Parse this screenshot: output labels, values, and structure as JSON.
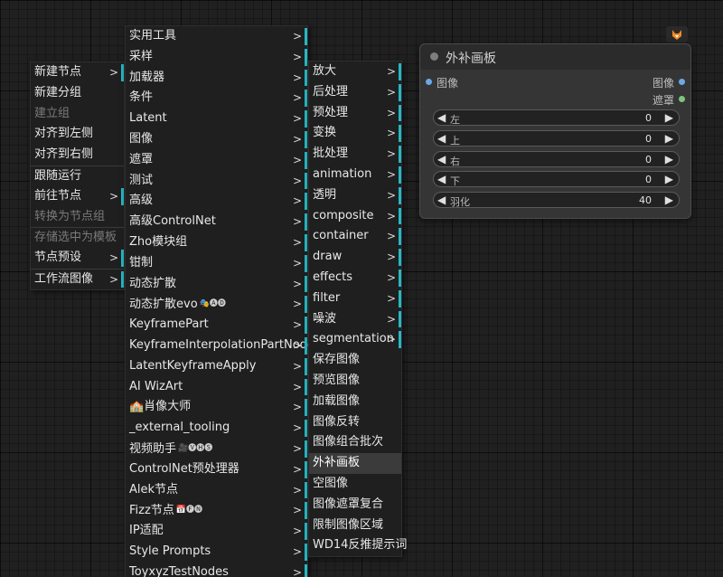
{
  "menu1": {
    "items": [
      {
        "label": "新建节点",
        "submenu": true,
        "disabled": false
      },
      {
        "label": "新建分组",
        "submenu": false,
        "disabled": false
      },
      {
        "label": "建立组",
        "submenu": false,
        "disabled": true
      },
      {
        "label": "对齐到左侧",
        "submenu": false,
        "disabled": false
      },
      {
        "label": "对齐到右侧",
        "submenu": false,
        "disabled": false
      },
      {
        "label": "跟随运行",
        "submenu": false,
        "disabled": false,
        "sep": true
      },
      {
        "label": "前往节点",
        "submenu": true,
        "disabled": false
      },
      {
        "label": "转换为节点组",
        "submenu": false,
        "disabled": true
      },
      {
        "label": "存储选中为模板",
        "submenu": false,
        "disabled": true,
        "sep": true
      },
      {
        "label": "节点预设",
        "submenu": true,
        "disabled": false
      },
      {
        "label": "工作流图像",
        "submenu": true,
        "disabled": false,
        "sep": true
      }
    ]
  },
  "menu2": {
    "items": [
      {
        "label": "实用工具",
        "submenu": true
      },
      {
        "label": "采样",
        "submenu": true
      },
      {
        "label": "加载器",
        "submenu": true
      },
      {
        "label": "条件",
        "submenu": true
      },
      {
        "label": "Latent",
        "submenu": true
      },
      {
        "label": "图像",
        "submenu": true
      },
      {
        "label": "遮罩",
        "submenu": true
      },
      {
        "label": "测试",
        "submenu": true
      },
      {
        "label": "高级",
        "submenu": true
      },
      {
        "label": "高级ControlNet",
        "submenu": true
      },
      {
        "label": "Zho模块组",
        "submenu": true
      },
      {
        "label": "钳制",
        "submenu": true
      },
      {
        "label": "动态扩散",
        "submenu": true
      },
      {
        "label": "动态扩散evo",
        "submenu": true,
        "badge": "🎭🅐🅓"
      },
      {
        "label": "KeyframePart",
        "submenu": true
      },
      {
        "label": "KeyframeInterpolationPartNode",
        "submenu": true
      },
      {
        "label": "LatentKeyframeApply",
        "submenu": true
      },
      {
        "label": "AI WizArt",
        "submenu": true
      },
      {
        "label": "🏫肖像大师",
        "submenu": true
      },
      {
        "label": "_external_tooling",
        "submenu": true
      },
      {
        "label": "视频助手",
        "submenu": true,
        "badge": "🎥🅥🅗🅢"
      },
      {
        "label": "ControlNet预处理器",
        "submenu": true
      },
      {
        "label": "Alek节点",
        "submenu": true
      },
      {
        "label": "Fizz节点",
        "submenu": true,
        "badge": "📅🅕🅝"
      },
      {
        "label": "IP适配",
        "submenu": true
      },
      {
        "label": "Style Prompts",
        "submenu": true
      },
      {
        "label": "ToyxyzTestNodes",
        "submenu": true
      }
    ]
  },
  "menu3": {
    "items": [
      {
        "label": "放大",
        "submenu": true
      },
      {
        "label": "后处理",
        "submenu": true
      },
      {
        "label": "预处理",
        "submenu": true
      },
      {
        "label": "变换",
        "submenu": true
      },
      {
        "label": "批处理",
        "submenu": true
      },
      {
        "label": "animation",
        "submenu": true
      },
      {
        "label": "透明",
        "submenu": true
      },
      {
        "label": "composite",
        "submenu": true
      },
      {
        "label": "container",
        "submenu": true
      },
      {
        "label": "draw",
        "submenu": true
      },
      {
        "label": "effects",
        "submenu": true
      },
      {
        "label": "filter",
        "submenu": true
      },
      {
        "label": "噪波",
        "submenu": true
      },
      {
        "label": "segmentation",
        "submenu": true
      },
      {
        "label": "保存图像",
        "submenu": false
      },
      {
        "label": "预览图像",
        "submenu": false
      },
      {
        "label": "加载图像",
        "submenu": false
      },
      {
        "label": "图像反转",
        "submenu": false
      },
      {
        "label": "图像组合批次",
        "submenu": false
      },
      {
        "label": "外补画板",
        "submenu": false,
        "highlight": true
      },
      {
        "label": "空图像",
        "submenu": false
      },
      {
        "label": "图像遮罩复合",
        "submenu": false
      },
      {
        "label": "限制图像区域",
        "submenu": false
      },
      {
        "label": "WD14反推提示词",
        "submenu": false
      }
    ]
  },
  "node": {
    "title": "外补画板",
    "input_label": "图像",
    "outputs": [
      "图像",
      "遮罩"
    ],
    "widgets": [
      {
        "label": "左",
        "value": "0"
      },
      {
        "label": "上",
        "value": "0"
      },
      {
        "label": "右",
        "value": "0"
      },
      {
        "label": "下",
        "value": "0"
      },
      {
        "label": "羽化",
        "value": "40"
      }
    ],
    "colors": {
      "input_port": "#6aa9e8",
      "output_image_port": "#6aa9e8",
      "output_mask_port": "#7ec47e"
    }
  },
  "arrow_glyph": ">",
  "icons": {
    "top_right": "fox-icon",
    "widget_left": "◀",
    "widget_right": "▶"
  }
}
